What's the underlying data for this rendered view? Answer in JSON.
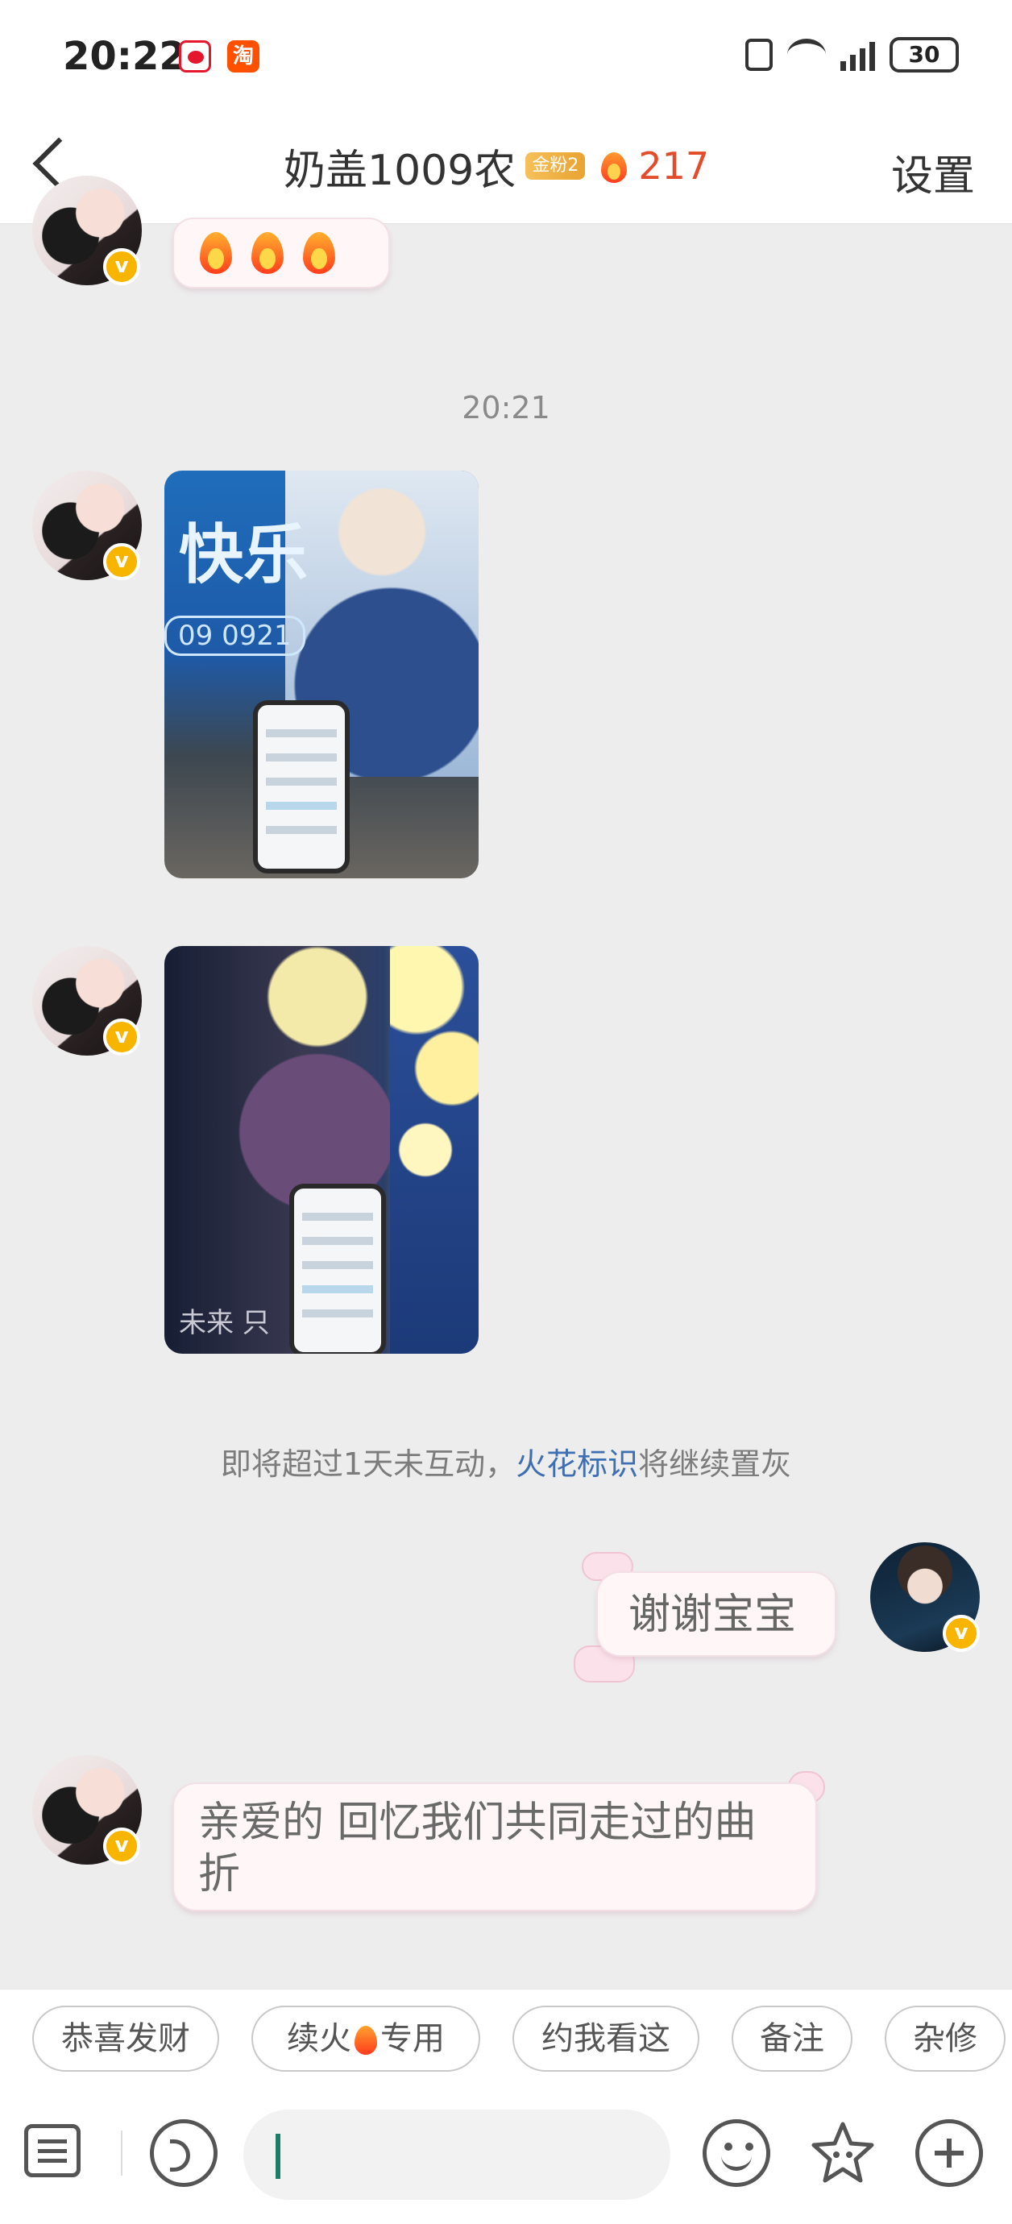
{
  "status_bar": {
    "time": "20:22",
    "taobao_glyph": "淘",
    "battery": "30"
  },
  "header": {
    "title": "奶盖1009农",
    "fan_badge": "金粉2",
    "streak_count": "217",
    "settings_label": "设置"
  },
  "messages": {
    "timestamp": "20:21",
    "notice_prefix": "即将超过1天未互动，",
    "notice_link": "火花标识",
    "notice_suffix": "将继续置灰",
    "sent_text": "谢谢宝宝",
    "received_text": "亲爱的 回忆我们共同走过的曲折",
    "photo1_overlay_text": "快乐",
    "photo1_date": "09 0921",
    "photo2_overlay_text": "未来 只"
  },
  "quick_replies": {
    "reply1": "恭喜发财",
    "reply2_prefix": "续火",
    "reply2_suffix": "专用",
    "reply3": "约我看这",
    "reply4": "备注",
    "reply5": "杂修"
  },
  "input_bar": {
    "value": ""
  },
  "colors": {
    "streak_red": "#e44b2b",
    "link_blue": "#3f6fb3",
    "verified_gold": "#f7b500"
  }
}
